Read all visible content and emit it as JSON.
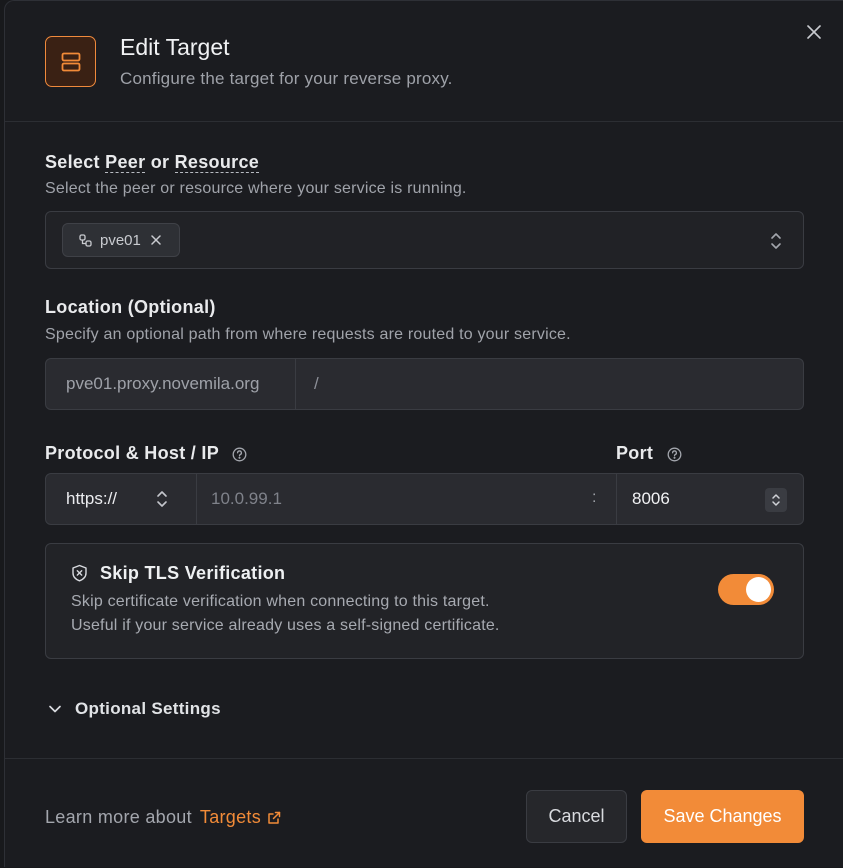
{
  "dialog": {
    "title": "Edit Target",
    "subtitle": "Configure the target for your reverse proxy."
  },
  "peer_section": {
    "label_prefix": "Select",
    "label_peer": "Peer",
    "label_or": "or",
    "label_resource": "Resource",
    "description": "Select the peer or resource where your service is running.",
    "selected_chip": "pve01"
  },
  "location_section": {
    "label": "Location (Optional)",
    "description": "Specify an optional path from where requests are routed to your service.",
    "domain": "pve01.proxy.novemila.org",
    "path_placeholder": "/"
  },
  "protocol_section": {
    "label": "Protocol & Host / IP",
    "protocol_value": "https://",
    "host_placeholder": "10.0.99.1",
    "separator": ":"
  },
  "port_section": {
    "label": "Port",
    "value": "8006"
  },
  "tls": {
    "title": "Skip TLS Verification",
    "description_line1": "Skip certificate verification when connecting to this target.",
    "description_line2": "Useful if your service already uses a self-signed certificate.",
    "enabled": true
  },
  "optional_settings": {
    "label": "Optional Settings"
  },
  "footer": {
    "learn_more": "Learn more about",
    "learn_link": "Targets",
    "cancel_label": "Cancel",
    "save_label": "Save Changes"
  },
  "colors": {
    "accent": "#f28b38",
    "background": "#1b1c20"
  }
}
